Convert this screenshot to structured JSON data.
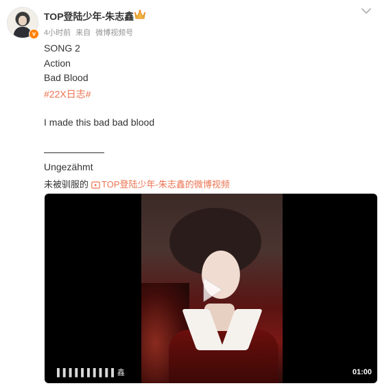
{
  "header": {
    "username": "TOP登陆少年-朱志鑫",
    "time": "4小时前",
    "source_prefix": "来自",
    "source": "微博视频号"
  },
  "post": {
    "lines": [
      "SONG 2",
      "Action",
      "Bad Blood"
    ],
    "hashtag": "#22X日志#",
    "lyric": "I made this bad bad blood",
    "subtitle": "Ungezähmt",
    "ref_prefix": "未被驯服的",
    "ref_link": "TOP登陆少年-朱志鑫的微博视频"
  },
  "video": {
    "duration": "01:00",
    "watermark": "▌▌▌▌▌▌▌▌▌▌鑫"
  },
  "icons": {
    "verified": "verified-badge-icon",
    "crown": "crown-icon",
    "more": "chevron-down-icon",
    "video_link": "video-link-icon",
    "play": "play-icon"
  },
  "colors": {
    "accent": "#eb7350",
    "verified": "#ff8200"
  }
}
